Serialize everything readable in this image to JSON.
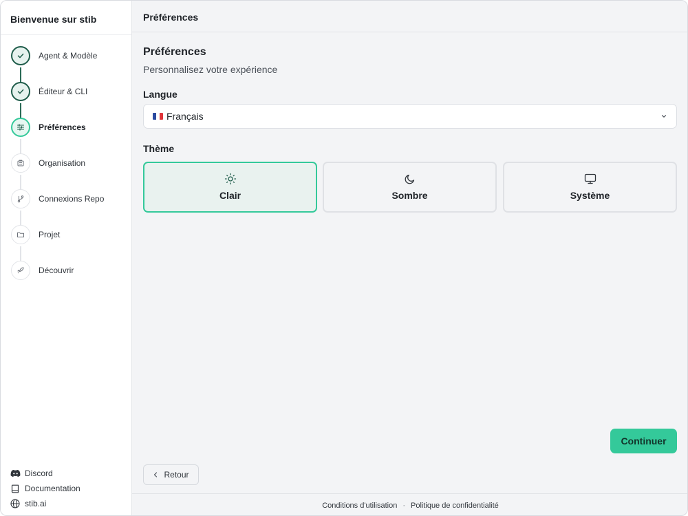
{
  "sidebar": {
    "title": "Bienvenue sur stib",
    "steps": [
      {
        "label": "Agent & Modèle",
        "state": "done",
        "icon": "check-icon"
      },
      {
        "label": "Éditeur & CLI",
        "state": "done",
        "icon": "check-icon"
      },
      {
        "label": "Préférences",
        "state": "active",
        "icon": "sliders-icon"
      },
      {
        "label": "Organisation",
        "state": "pending",
        "icon": "building-icon"
      },
      {
        "label": "Connexions Repo",
        "state": "pending",
        "icon": "git-branch-icon"
      },
      {
        "label": "Projet",
        "state": "pending",
        "icon": "folder-icon"
      },
      {
        "label": "Découvrir",
        "state": "pending",
        "icon": "rocket-icon"
      }
    ],
    "links": [
      {
        "label": "Discord",
        "icon": "discord-icon"
      },
      {
        "label": "Documentation",
        "icon": "book-icon"
      },
      {
        "label": "stib.ai",
        "icon": "globe-icon"
      }
    ]
  },
  "header": {
    "title": "Préférences"
  },
  "main": {
    "section_title": "Préférences",
    "section_subtitle": "Personnalisez votre expérience",
    "language": {
      "label": "Langue",
      "selected": "Français",
      "flag": "flag-fr-icon"
    },
    "theme": {
      "label": "Thème",
      "options": [
        {
          "label": "Clair",
          "icon": "sun-icon",
          "selected": true
        },
        {
          "label": "Sombre",
          "icon": "moon-icon",
          "selected": false
        },
        {
          "label": "Système",
          "icon": "monitor-icon",
          "selected": false
        }
      ]
    },
    "continue_label": "Continuer",
    "back_label": "Retour"
  },
  "footer": {
    "terms": "Conditions d'utilisation",
    "separator": "·",
    "privacy": "Politique de confidentialité"
  },
  "colors": {
    "accent": "#34c99a",
    "done_step": "#1f5c4a",
    "selected_card_bg": "#e9f2ef"
  }
}
